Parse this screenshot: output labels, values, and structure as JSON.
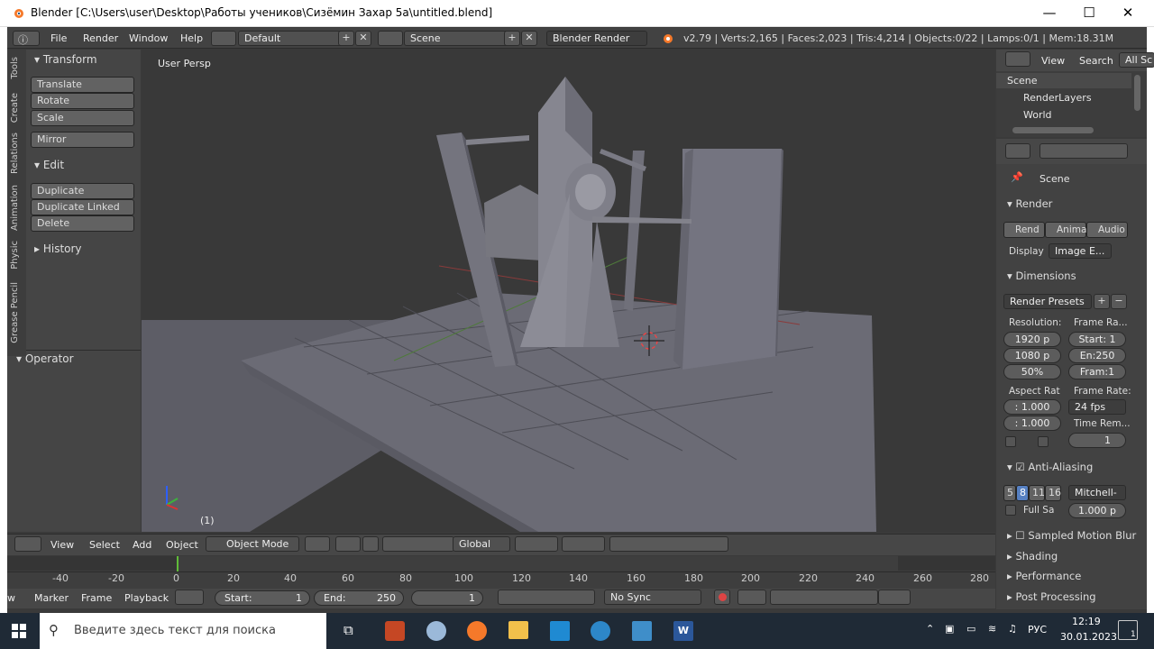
{
  "window": {
    "title": "Blender [C:\\Users\\user\\Desktop\\Работы учеников\\Сизёмин Захар 5а\\untitled.blend]",
    "minimize": "—",
    "maximize": "☐",
    "close": "✕"
  },
  "info_header": {
    "menus": [
      "File",
      "Render",
      "Window",
      "Help"
    ],
    "layout": "Default",
    "scene": "Scene",
    "engine": "Blender Render",
    "stats": "v2.79 | Verts:2,165 | Faces:2,023 | Tris:4,214 | Objects:0/22 | Lamps:0/1 | Mem:18.31M"
  },
  "tool_tabs": [
    "Tools",
    "Create",
    "Relations",
    "Animation",
    "Physic",
    "Grease Pencil"
  ],
  "tool_shelf": {
    "transform_title": "Transform",
    "translate": "Translate",
    "rotate": "Rotate",
    "scale": "Scale",
    "mirror": "Mirror",
    "edit_title": "Edit",
    "duplicate": "Duplicate",
    "duplicate_linked": "Duplicate Linked",
    "delete": "Delete",
    "history_title": "History",
    "operator_title": "Operator"
  },
  "viewport": {
    "view_label": "User Persp",
    "frame_label": "(1)"
  },
  "viewport_header": {
    "menus": [
      "View",
      "Select",
      "Add",
      "Object"
    ],
    "mode": "Object Mode",
    "orientation": "Global"
  },
  "timeline": {
    "ticks": [
      "-40",
      "-20",
      "0",
      "20",
      "40",
      "60",
      "80",
      "100",
      "120",
      "140",
      "160",
      "180",
      "200",
      "220",
      "240",
      "260",
      "280"
    ]
  },
  "timeline_header": {
    "menus": [
      "w",
      "Marker",
      "Frame",
      "Playback"
    ],
    "start_label": "Start:",
    "start_value": "1",
    "end_label": "End:",
    "end_value": "250",
    "current_frame": "1",
    "sync": "No Sync"
  },
  "outliner": {
    "view": "View",
    "search": "Search",
    "filter": "All Sc",
    "items": [
      "Scene",
      "RenderLayers",
      "World"
    ]
  },
  "properties": {
    "context": "Scene",
    "render_title": "Render",
    "render_btn": "Rend",
    "anim_btn": "Anima",
    "audio_btn": "Audio",
    "display_label": "Display",
    "display_value": "Image E...",
    "dimensions_title": "Dimensions",
    "render_presets": "Render Presets",
    "resolution_label": "Resolution:",
    "res_x": "1920 p",
    "res_y": "1080 p",
    "res_pct": "50%",
    "frame_range_label": "Frame Ra...",
    "frame_start": "Start: 1",
    "frame_end": "En:250",
    "frame_step": "Fram:1",
    "aspect_label": "Aspect Rat",
    "aspect_x": ": 1.000",
    "aspect_y": ": 1.000",
    "frame_rate_label": "Frame Rate:",
    "frame_rate": "24 fps",
    "time_remap_label": "Time Rem...",
    "time_remap_value": "1",
    "aa_title": "Anti-Aliasing",
    "aa_samples": [
      "5",
      "8",
      "11",
      "16"
    ],
    "aa_filter": "Mitchell-",
    "full_sample": "Full Sa",
    "filter_size": "1.000 p",
    "motion_blur": "Sampled Motion Blur",
    "shading": "Shading",
    "performance": "Performance",
    "post_processing": "Post Processing"
  },
  "taskbar": {
    "search_placeholder": "Введите здесь текст для поиска",
    "language": "РУС",
    "time": "12:19",
    "date": "30.01.2023",
    "notification_count": "1"
  }
}
